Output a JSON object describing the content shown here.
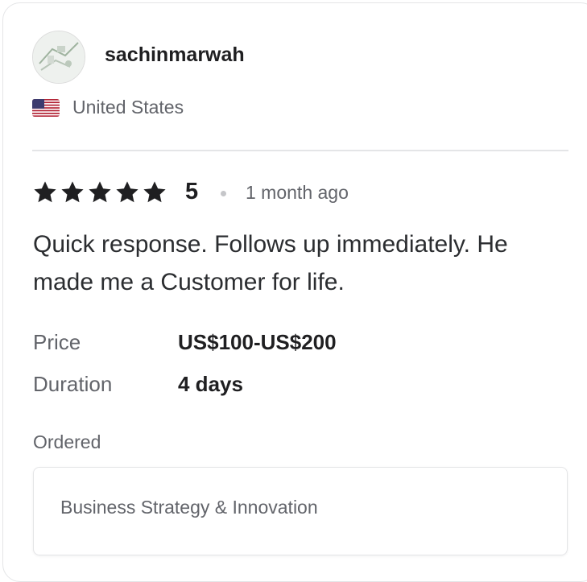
{
  "reviewer": {
    "username": "sachinmarwah",
    "country": "United States"
  },
  "review": {
    "stars": 5,
    "rating": "5",
    "time_ago": "1 month ago",
    "text": "Quick response. Follows up immediately. He made me a Customer for life."
  },
  "details": {
    "price_label": "Price",
    "price_value": "US$100-US$200",
    "duration_label": "Duration",
    "duration_value": "4 days"
  },
  "ordered": {
    "label": "Ordered",
    "service": "Business Strategy & Innovation"
  },
  "colors": {
    "star": "#1f1f21",
    "muted_text": "#62646a",
    "divider": "#e4e5e7"
  }
}
